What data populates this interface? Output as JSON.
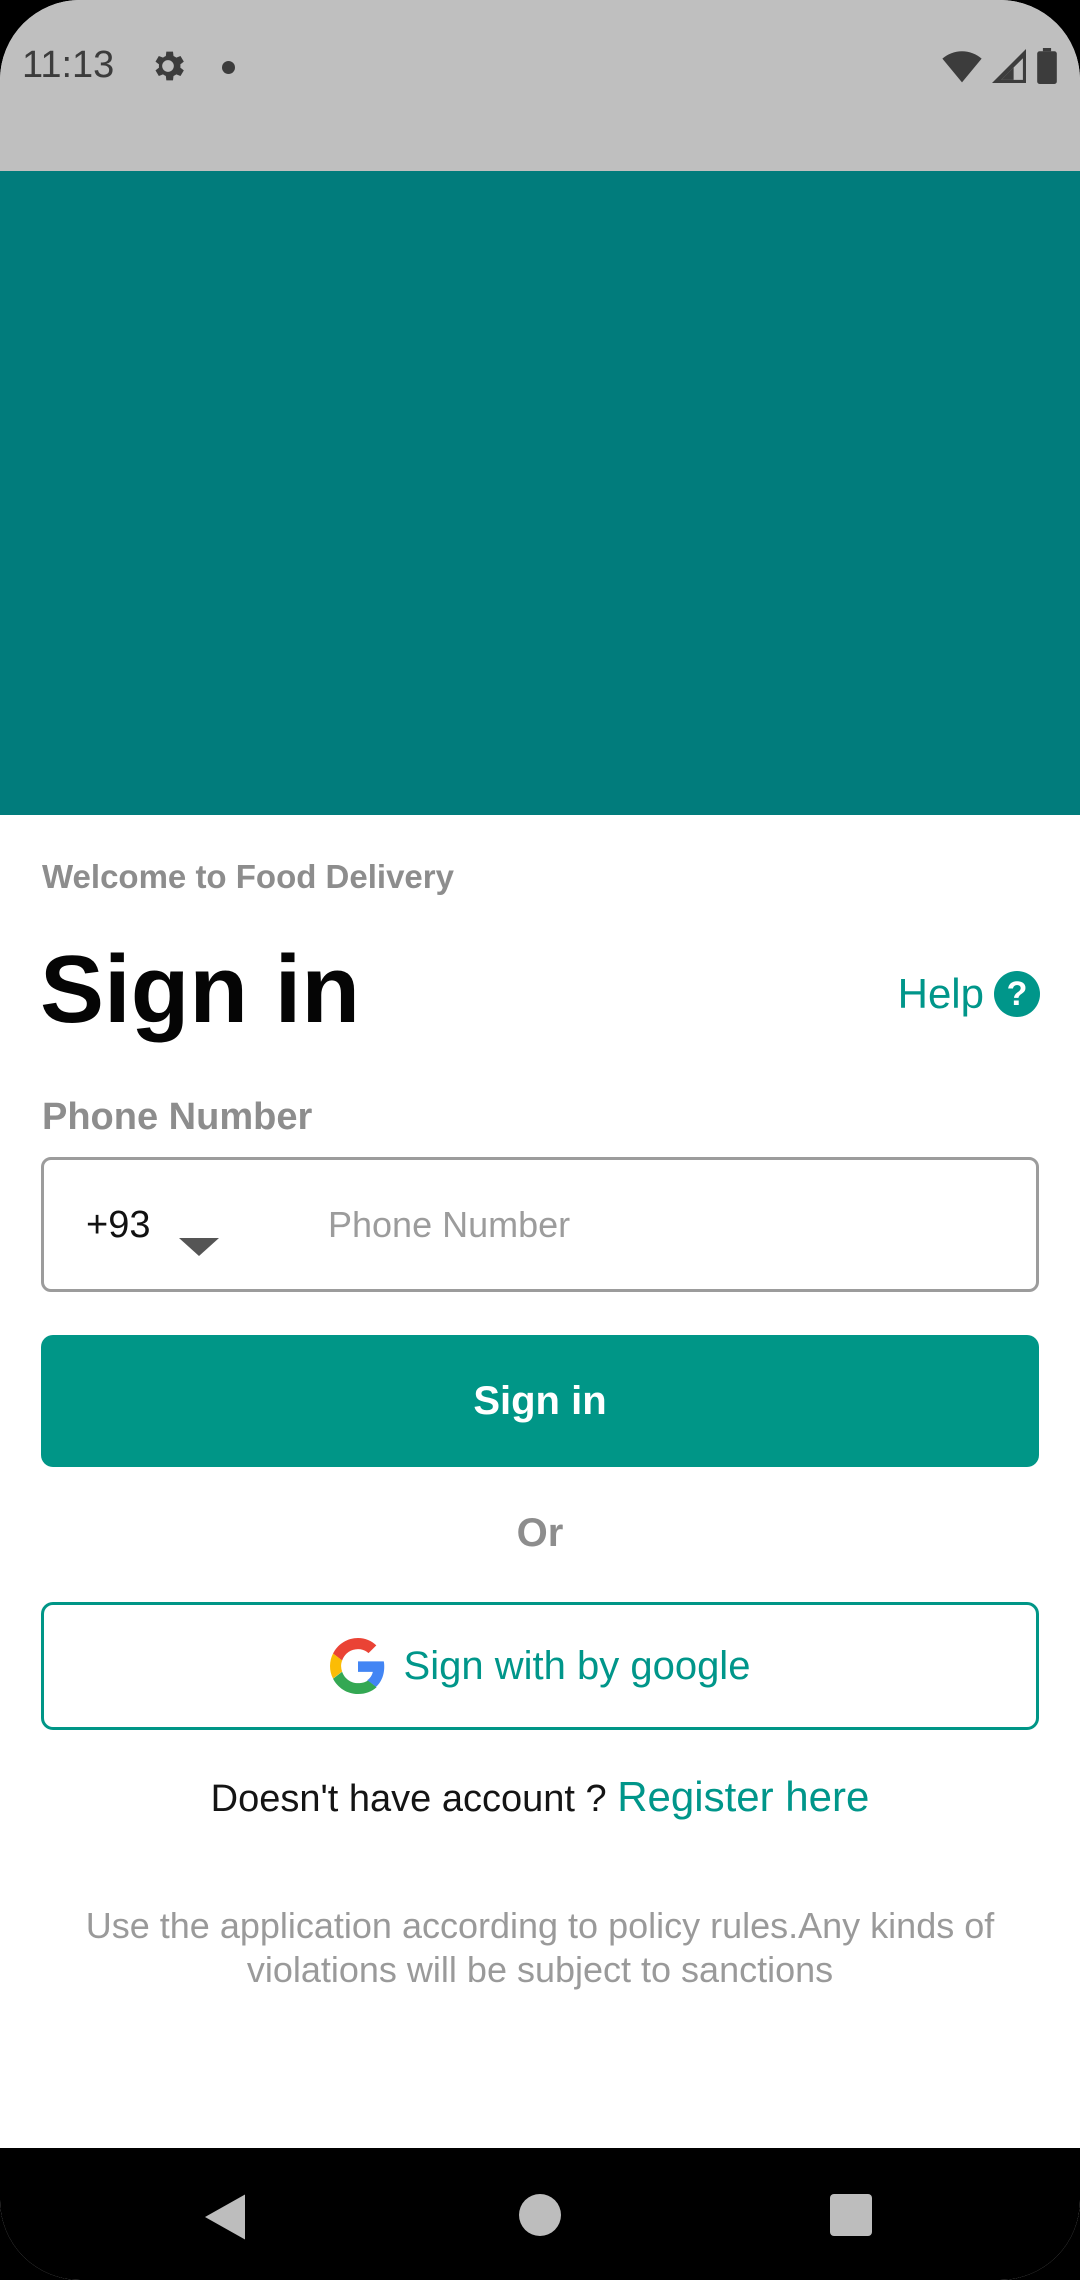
{
  "status_bar": {
    "time": "11:13",
    "icons": [
      "gear-icon",
      "notification-dot-icon",
      "wifi-icon",
      "signal-icon",
      "battery-icon"
    ]
  },
  "colors": {
    "brand_teal": "#00968a",
    "hero_teal": "#017c7c",
    "muted_text": "#8d8d8d"
  },
  "header": {
    "welcome": "Welcome to Food Delivery",
    "title": "Sign in",
    "help_label": "Help",
    "help_icon": "question-icon"
  },
  "form": {
    "phone_label": "Phone Number",
    "country_code": "+93",
    "phone_value": "",
    "phone_placeholder": "Phone Number",
    "signin_button": "Sign in",
    "or_text": "Or",
    "google_button": "Sign with by google",
    "register_prompt": "Doesn't have account ? ",
    "register_link": "Register here"
  },
  "footer": {
    "policy": "Use the application according to policy rules.Any kinds of violations will be subject to sanctions"
  },
  "nav_bar": {
    "buttons": [
      "back-icon",
      "home-icon",
      "recents-icon"
    ]
  }
}
